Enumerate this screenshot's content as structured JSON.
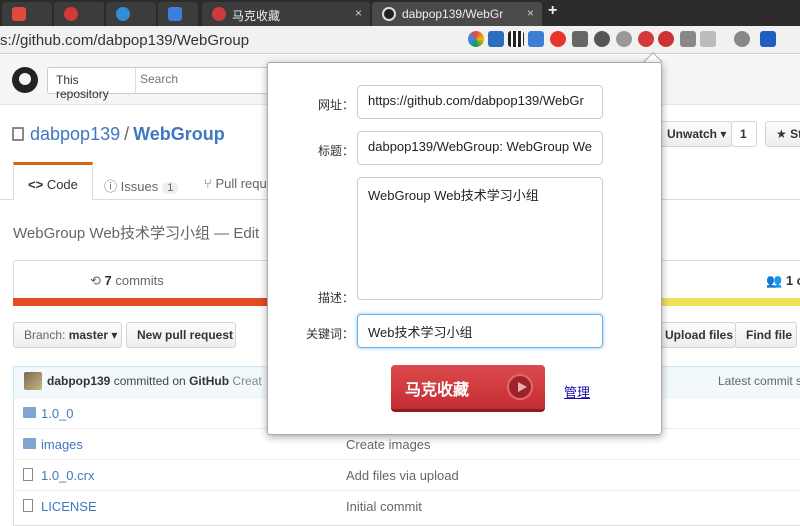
{
  "browser": {
    "tabs": [
      {
        "title": "",
        "favicon_color": "#e04a3f"
      },
      {
        "title": "",
        "favicon_color": "#d03a3a"
      },
      {
        "title": "",
        "favicon_color": "#2f8fd6"
      },
      {
        "title": "",
        "favicon_color": "#3a7fe0"
      },
      {
        "title": "马克收藏",
        "favicon_color": "#d03a3a"
      },
      {
        "title": "dabpop139/WebGr",
        "favicon_color": "#222222"
      }
    ],
    "new_tab_label": "+",
    "close_label": "×",
    "url": "s://github.com/dabpop139/WebGroup",
    "extensions": [
      "color-wheel-icon",
      "mail-icon",
      "qr-code-icon",
      "translate-icon",
      "adblock-icon",
      "pocket-icon",
      "recycle-icon",
      "gear-icon",
      "mark-icon",
      "block-icon",
      "star-icon",
      "grid-icon",
      "reload-icon",
      "paw-icon"
    ]
  },
  "github": {
    "search_scope": "This repository",
    "search_placeholder": "Search",
    "repo_owner": "dabpop139",
    "repo_separator": "/",
    "repo_name": "WebGroup",
    "unwatch_label": "Unwatch ▾",
    "watch_count": "1",
    "star_label": "St",
    "tabs": {
      "code": "Code",
      "issues": "Issues",
      "issues_count": "1",
      "pull_requests": "Pull requ"
    },
    "description": "WebGroup Web技术学习小组",
    "description_edit": " — Edit",
    "commits_count": "7",
    "commits_label": " commits",
    "contributors_count": "1 c",
    "branch_label": "Branch: ",
    "branch_name": "master ▾",
    "new_pr_label": "New pull request",
    "upload_label": "Upload files",
    "find_label": "Find file",
    "commit_author": "dabpop139",
    "commit_text": " committed on ",
    "commit_platform": "GitHub",
    "commit_trailing": " Creat",
    "latest_commit": "Latest commit s",
    "files": [
      {
        "name": "1.0_0",
        "type": "dir",
        "message": ""
      },
      {
        "name": "images",
        "type": "dir",
        "message": "Create images"
      },
      {
        "name": "1.0_0.crx",
        "type": "file",
        "message": "Add files via upload"
      },
      {
        "name": "LICENSE",
        "type": "file",
        "message": "Initial commit"
      }
    ],
    "lang_colors": [
      "#e44b23",
      "#f1e05a"
    ]
  },
  "popup": {
    "url_label": "网址：",
    "url_value": "https://github.com/dabpop139/WebGr",
    "title_label": "标题：",
    "title_value": "dabpop139/WebGroup: WebGroup We",
    "desc_label": "描述：",
    "desc_value": "WebGroup Web技术学习小组",
    "keywords_label": "关键词：",
    "keywords_value": "Web技术学习小组",
    "save_label": "马克收藏",
    "manage_label": "管理",
    "accent_color": "#c42d34"
  }
}
